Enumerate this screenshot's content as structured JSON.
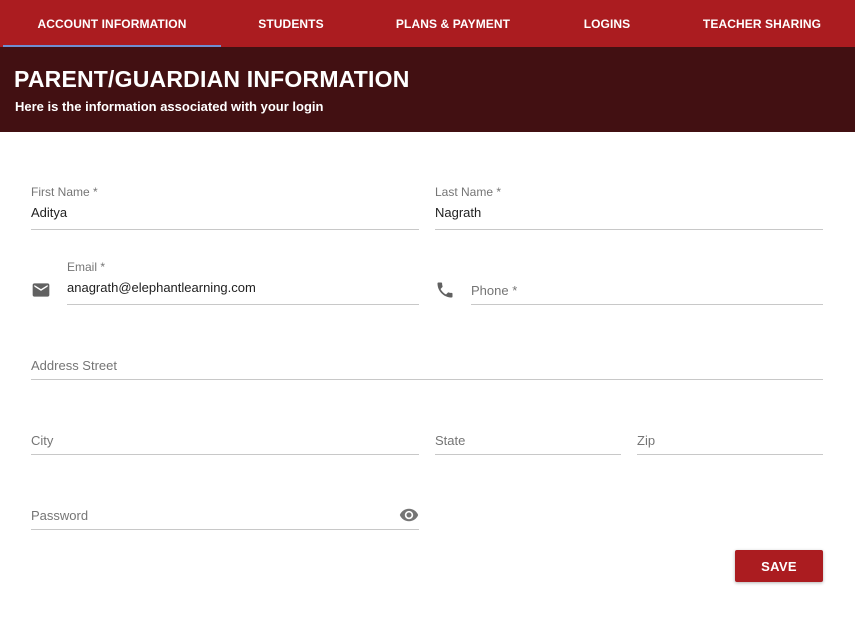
{
  "tabs": [
    {
      "label": "ACCOUNT INFORMATION",
      "active": true
    },
    {
      "label": "STUDENTS",
      "active": false
    },
    {
      "label": "PLANS & PAYMENT",
      "active": false
    },
    {
      "label": "LOGINS",
      "active": false
    },
    {
      "label": "TEACHER SHARING",
      "active": false
    }
  ],
  "colors": {
    "tab_bar": "#ab1c20",
    "banner": "#421012",
    "active_tab_indicator": "#6f8fd1",
    "save_button": "#ab1c20"
  },
  "banner": {
    "title": "PARENT/GUARDIAN INFORMATION",
    "subtitle": "Here is the information associated with your login"
  },
  "form": {
    "first_name": {
      "label": "First Name *",
      "value": "Aditya"
    },
    "last_name": {
      "label": "Last Name *",
      "value": "Nagrath"
    },
    "email": {
      "label": "Email *",
      "value": "anagrath@elephantlearning.com",
      "icon": "email-icon"
    },
    "phone": {
      "placeholder": "Phone *",
      "value": "",
      "icon": "phone-icon"
    },
    "address_street": {
      "placeholder": "Address Street",
      "value": ""
    },
    "city": {
      "placeholder": "City",
      "value": ""
    },
    "state": {
      "placeholder": "State",
      "value": ""
    },
    "zip": {
      "placeholder": "Zip",
      "value": ""
    },
    "password": {
      "placeholder": "Password",
      "value": "",
      "icon": "eye-icon"
    },
    "save_label": "SAVE"
  }
}
